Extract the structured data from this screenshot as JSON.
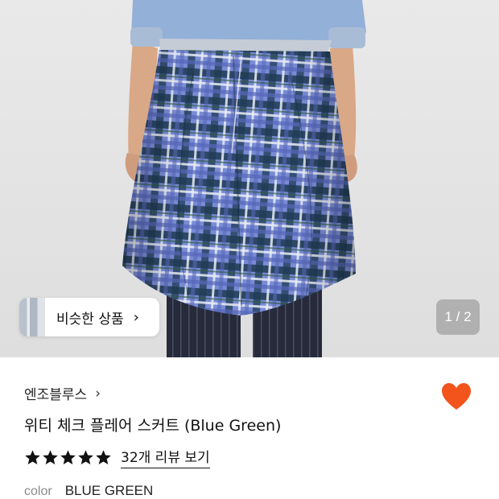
{
  "product_image": {
    "alt_icon": "product-photo",
    "similar_button": {
      "label": "비슷한 상품",
      "chevron": "›"
    },
    "page_counter": "1 / 2"
  },
  "product_info": {
    "brand": "엔조블루스",
    "brand_chevron": "›",
    "title": "위티 체크 플레어 스커트 (Blue Green)",
    "rating": {
      "stars": 5,
      "review_link": "32개 리뷰 보기"
    },
    "color": {
      "label": "color",
      "value": "BLUE GREEN"
    },
    "wishlist": {
      "icon": "heart-icon",
      "active": true
    }
  },
  "colors": {
    "heart": "#f2541b",
    "plaid_base": "#6e7fd0",
    "plaid_dark": "#1f3a55"
  }
}
